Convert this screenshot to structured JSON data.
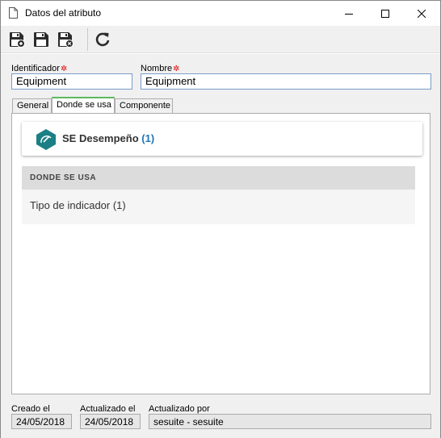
{
  "window": {
    "title": "Datos del atributo"
  },
  "toolbar": {
    "buttons": [
      "save-new",
      "save",
      "save-close",
      "refresh"
    ]
  },
  "form": {
    "identifier_label": "Identificador",
    "identifier_value": "Equipment",
    "name_label": "Nombre",
    "name_value": "Equipment",
    "required_mark": "✲"
  },
  "tabs": [
    {
      "label": "General"
    },
    {
      "label": "Donde se usa"
    },
    {
      "label": "Componente"
    }
  ],
  "card": {
    "title": "SE Desempeño",
    "count": "(1)"
  },
  "section": {
    "header": "DONDE SE USA",
    "items": [
      "Tipo de indicador (1)"
    ]
  },
  "footer": {
    "created_label": "Creado el",
    "created_value": "24/05/2018",
    "updated_label": "Actualizado el",
    "updated_value": "24/05/2018",
    "updated_by_label": "Actualizado por",
    "updated_by_value": "sesuite - sesuite"
  },
  "colors": {
    "accent_blue": "#1f74b8",
    "required_red": "#dd0000",
    "active_tab_green": "#5cb85c",
    "card_icon_teal": "#1b7f86"
  }
}
